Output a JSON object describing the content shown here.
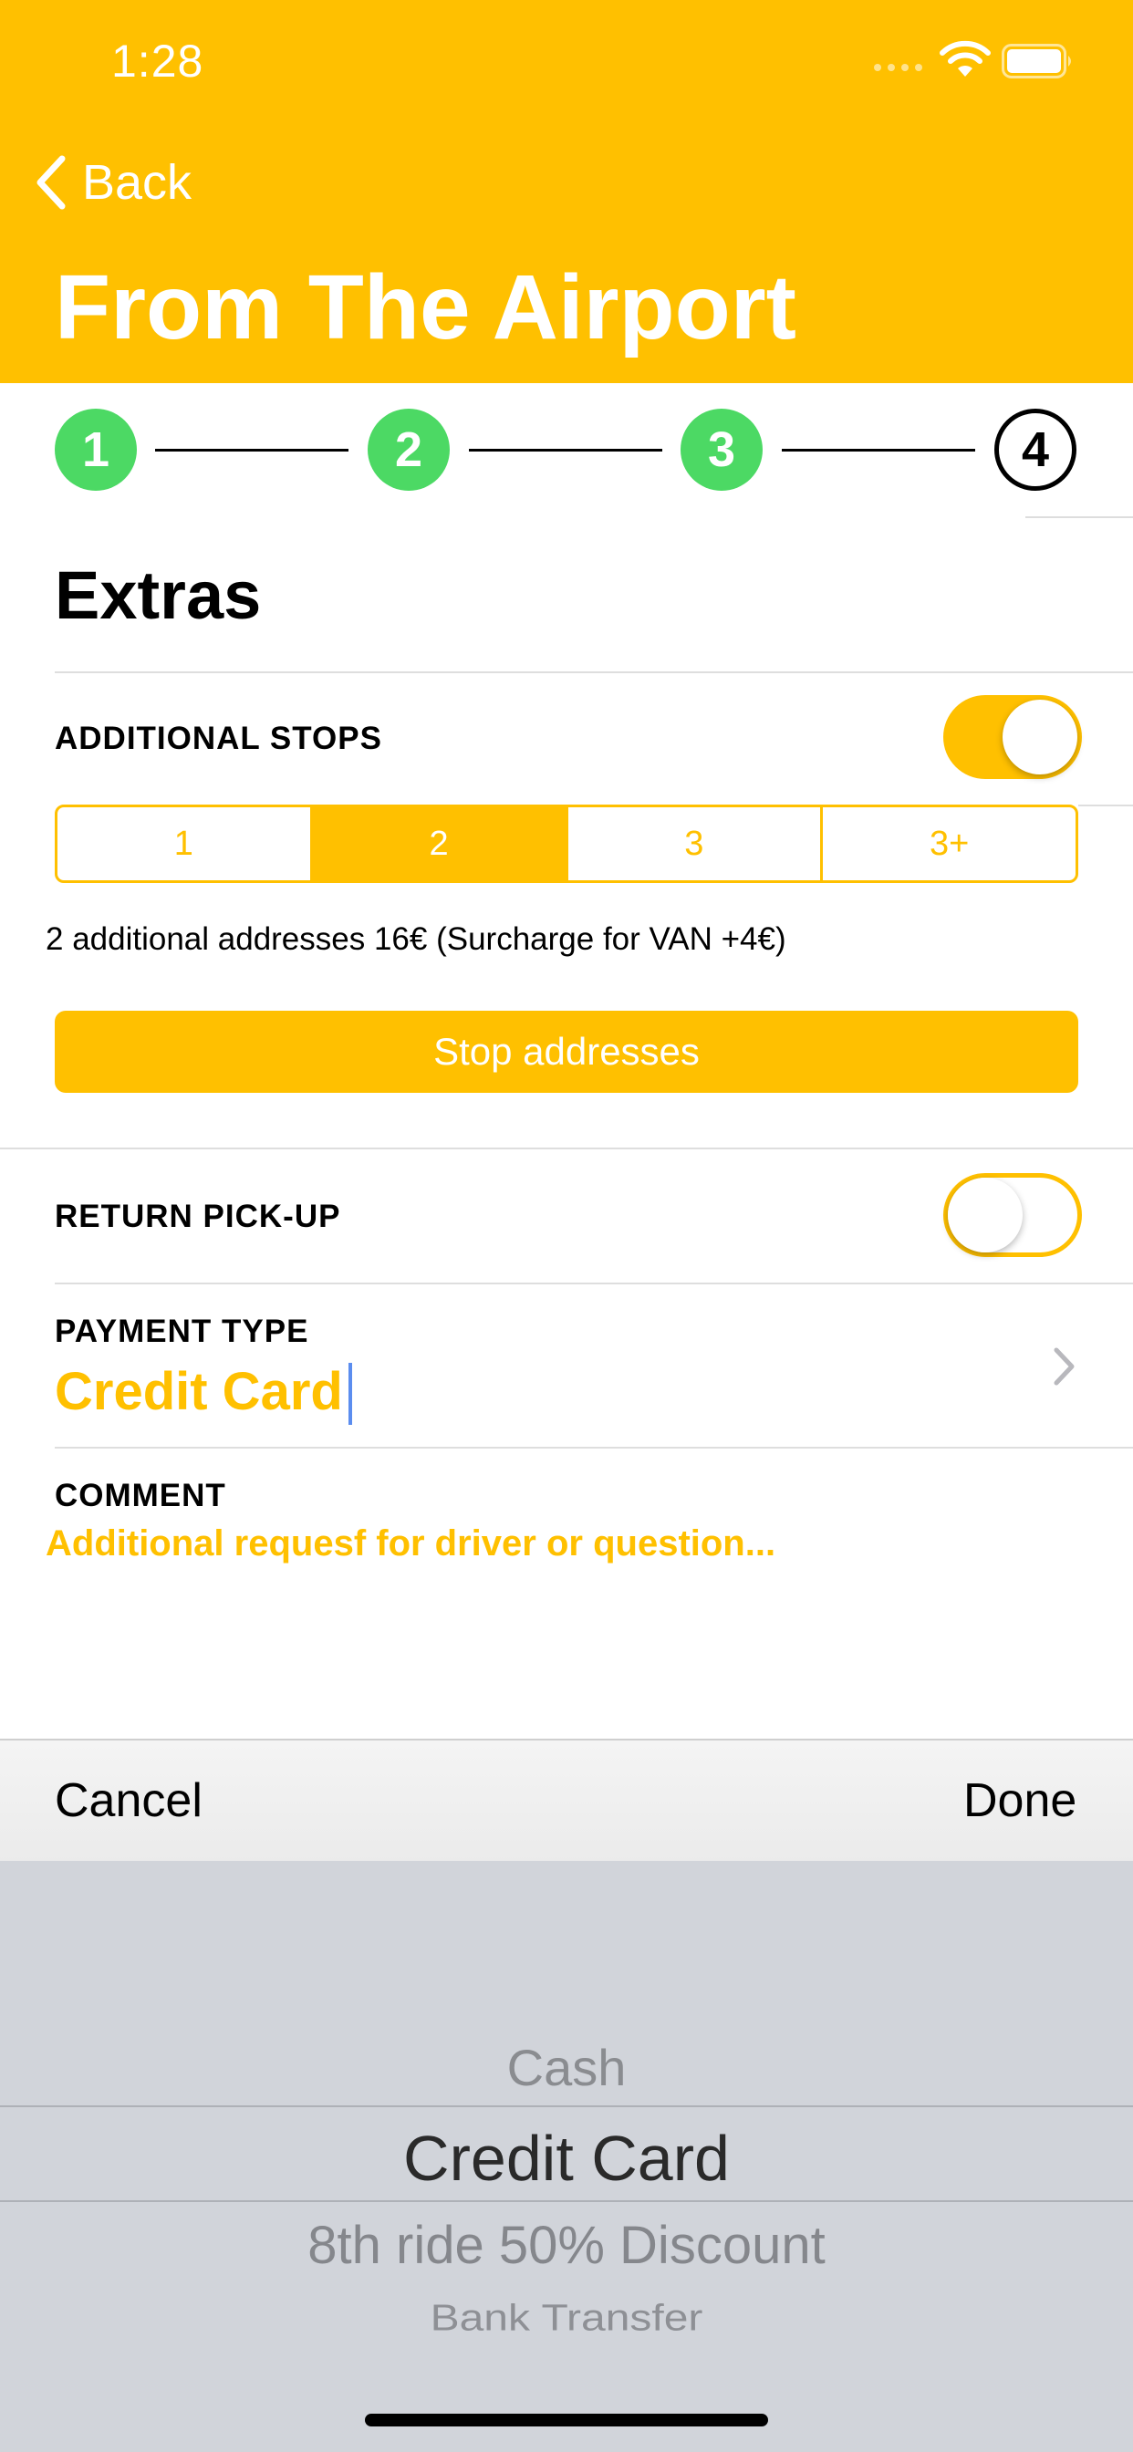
{
  "status_bar": {
    "time": "1:28"
  },
  "nav": {
    "back_label": "Back",
    "title": "From The Airport"
  },
  "stepper": {
    "steps": [
      "1",
      "2",
      "3",
      "4"
    ],
    "current_step": 4
  },
  "section": {
    "title": "Extras"
  },
  "additional_stops": {
    "label": "ADDITIONAL STOPS",
    "enabled": true,
    "options": [
      "1",
      "2",
      "3",
      "3+"
    ],
    "selected": "2",
    "info": "2 additional addresses 16€ (Surcharge for VAN +4€)",
    "button_label": "Stop addresses"
  },
  "return_pickup": {
    "label": "RETURN PICK-UP",
    "enabled": false
  },
  "payment": {
    "label": "PAYMENT TYPE",
    "value": "Credit Card"
  },
  "comment": {
    "label": "COMMENT",
    "placeholder": "Additional requesf for driver or question..."
  },
  "picker_toolbar": {
    "cancel_label": "Cancel",
    "done_label": "Done"
  },
  "picker": {
    "options": [
      "Cash",
      "Credit Card",
      "8th ride 50% Discount",
      "Bank Transfer"
    ],
    "selected": "Credit Card"
  },
  "colors": {
    "accent": "#FFC000",
    "step_done": "#4CD964",
    "picker_bg": "#D1D4DA"
  }
}
